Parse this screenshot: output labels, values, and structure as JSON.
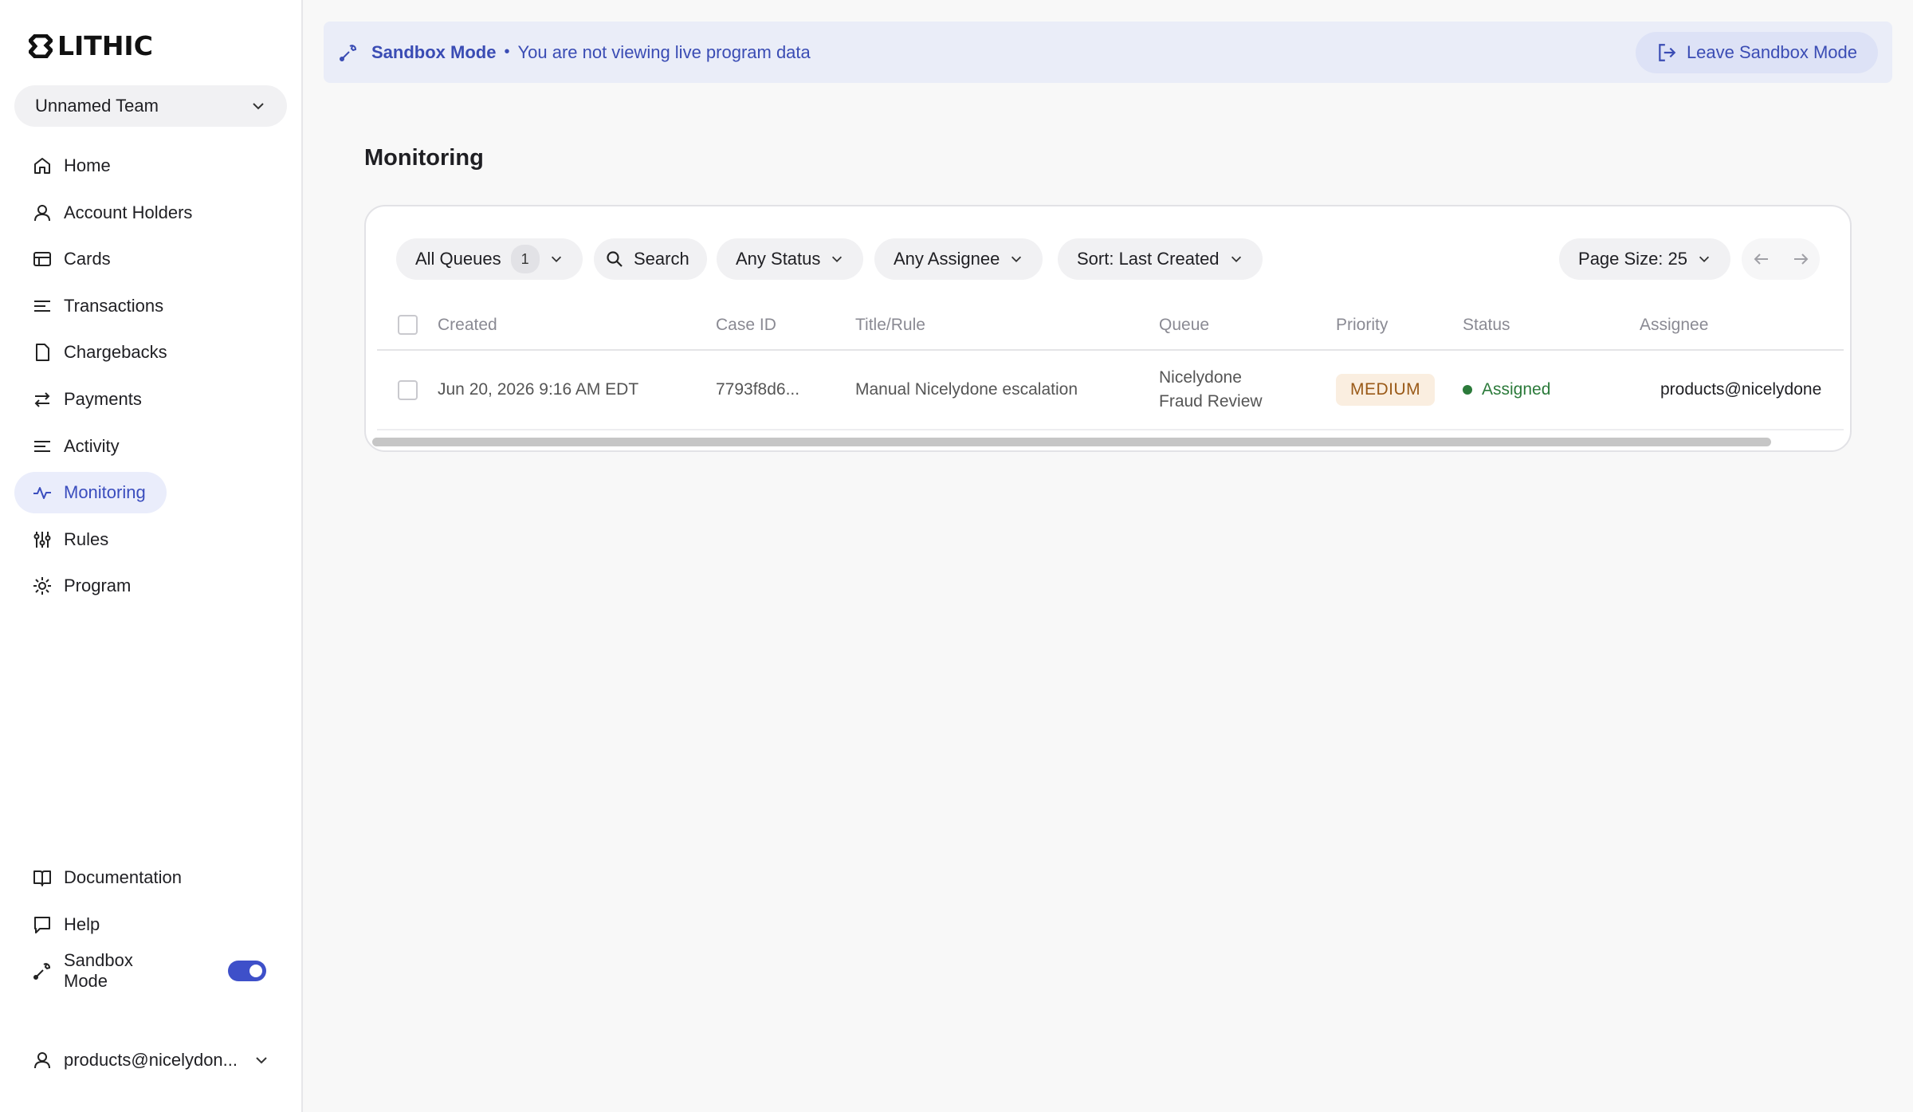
{
  "brand": {
    "name": "LITHIC"
  },
  "team": {
    "label": "Unnamed Team"
  },
  "nav": {
    "items": [
      {
        "label": "Home",
        "icon": "home-icon"
      },
      {
        "label": "Account Holders",
        "icon": "user-icon"
      },
      {
        "label": "Cards",
        "icon": "card-icon"
      },
      {
        "label": "Transactions",
        "icon": "lines-icon"
      },
      {
        "label": "Chargebacks",
        "icon": "file-icon"
      },
      {
        "label": "Payments",
        "icon": "swap-icon"
      },
      {
        "label": "Activity",
        "icon": "lines-icon"
      },
      {
        "label": "Monitoring",
        "icon": "pulse-icon",
        "active": true
      },
      {
        "label": "Rules",
        "icon": "sliders-icon"
      },
      {
        "label": "Program",
        "icon": "gear-icon"
      }
    ],
    "bottom": [
      {
        "label": "Documentation",
        "icon": "book-icon"
      },
      {
        "label": "Help",
        "icon": "chat-icon"
      },
      {
        "label": "Sandbox Mode",
        "icon": "wrench-icon",
        "toggle_on": true
      }
    ]
  },
  "user": {
    "label": "products@nicelydon..."
  },
  "banner": {
    "title": "Sandbox Mode",
    "separator": "•",
    "text": "You are not viewing live program data",
    "leave_label": "Leave Sandbox Mode"
  },
  "page": {
    "title": "Monitoring"
  },
  "toolbar": {
    "queues_label": "All Queues",
    "queues_count": "1",
    "search_label": "Search",
    "status_label": "Any Status",
    "assignee_label": "Any Assignee",
    "sort_label": "Sort: Last Created",
    "page_size_label": "Page Size: 25"
  },
  "table": {
    "columns": [
      "Created",
      "Case ID",
      "Title/Rule",
      "Queue",
      "Priority",
      "Status",
      "Assignee"
    ],
    "rows": [
      {
        "created": "Jun 20, 2026 9:16 AM EDT",
        "case_id": "7793f8d6...",
        "title": "Manual Nicelydone escalation",
        "queue_line1": "Nicelydone",
        "queue_line2": "Fraud Review",
        "priority": "MEDIUM",
        "status": "Assigned",
        "assignee": "products@nicelydone"
      }
    ]
  },
  "colors": {
    "accent": "#3e50c9",
    "active_nav_bg": "#eaedfb",
    "banner_bg": "#eaedf8",
    "status_green": "#2b7a3a",
    "priority_bg": "#faeee0"
  }
}
